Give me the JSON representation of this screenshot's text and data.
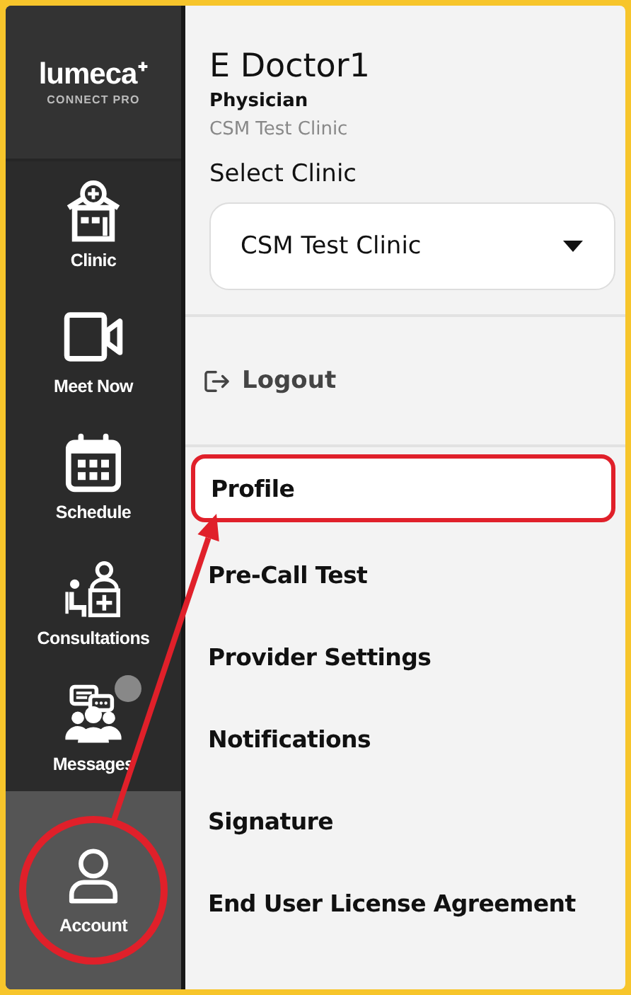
{
  "logo": {
    "name": "lumeca",
    "tagline": "CONNECT PRO"
  },
  "nav": [
    {
      "kind": "clinic",
      "label": "Clinic",
      "selected": false,
      "badge": false,
      "circled": false
    },
    {
      "kind": "video",
      "label": "Meet Now",
      "selected": false,
      "badge": false,
      "circled": false
    },
    {
      "kind": "calendar",
      "label": "Schedule",
      "selected": false,
      "badge": false,
      "circled": false
    },
    {
      "kind": "consult",
      "label": "Consultations",
      "selected": false,
      "badge": false,
      "circled": false
    },
    {
      "kind": "messages",
      "label": "Messages",
      "selected": false,
      "badge": true,
      "circled": false
    },
    {
      "kind": "account",
      "label": "Account",
      "selected": true,
      "badge": false,
      "circled": true
    }
  ],
  "user": {
    "name": "E Doctor1",
    "role": "Physician",
    "clinic": "CSM Test Clinic"
  },
  "clinic_select": {
    "label": "Select Clinic",
    "value": "CSM Test Clinic"
  },
  "logout": "Logout",
  "menu": [
    {
      "label": "Profile",
      "highlighted": true
    },
    {
      "label": "Pre-Call Test",
      "highlighted": false
    },
    {
      "label": "Provider Settings",
      "highlighted": false
    },
    {
      "label": "Notifications",
      "highlighted": false
    },
    {
      "label": "Signature",
      "highlighted": false
    },
    {
      "label": "End User License Agreement",
      "highlighted": false
    }
  ],
  "annotation_arrow": true
}
